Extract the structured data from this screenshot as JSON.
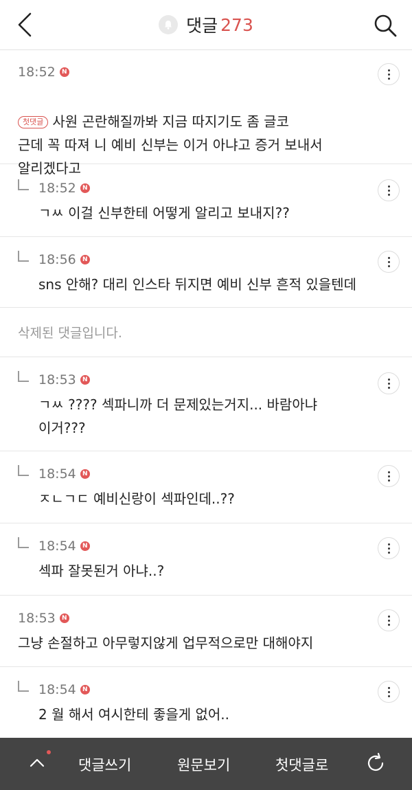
{
  "header": {
    "title": "댓글",
    "count": "273"
  },
  "comments": [
    {
      "time": "18:52",
      "badge": "N",
      "first_label": "첫댓글",
      "text": "사원 곤란해질까봐 지금 따지기도 좀 글코\n근데 꼭 따져 니 예비 신부는 이거 아냐고 증거 보내서\n알리겠다고"
    },
    {
      "time": "18:52",
      "badge": "N",
      "text": "ㄱㅆ 이걸 신부한테 어떻게 알리고 보내지??"
    },
    {
      "time": "18:56",
      "badge": "N",
      "text": "sns 안해? 대리 인스타 뒤지면 예비 신부 흔적 있을텐데"
    },
    {
      "text": "삭제된 댓글입니다."
    },
    {
      "time": "18:53",
      "badge": "N",
      "text": "ㄱㅆ ???? 섹파니까 더 문제있는거지... 바람아냐\n이거???"
    },
    {
      "time": "18:54",
      "badge": "N",
      "text": "ㅈㄴㄱㄷ 예비신랑이 섹파인데..??"
    },
    {
      "time": "18:54",
      "badge": "N",
      "text": "섹파 잘못된거 아냐..?"
    },
    {
      "time": "18:53",
      "badge": "N",
      "text": "그냥 손절하고 아무렇지않게 업무적으로만 대해야지"
    },
    {
      "time": "18:54",
      "badge": "N",
      "text": "2 월 해서 여시한테 좋을게 없어.."
    }
  ],
  "bottombar": {
    "write": "댓글쓰기",
    "original": "원문보기",
    "first": "첫댓글로"
  },
  "colors": {
    "accent": "#d9534f",
    "bar": "#444444"
  },
  "icons": {
    "back": "chevron-left-icon",
    "bell": "bell-icon",
    "search": "search-icon",
    "more": "more-vertical-icon",
    "up": "chevron-up-icon",
    "refresh": "refresh-icon"
  }
}
